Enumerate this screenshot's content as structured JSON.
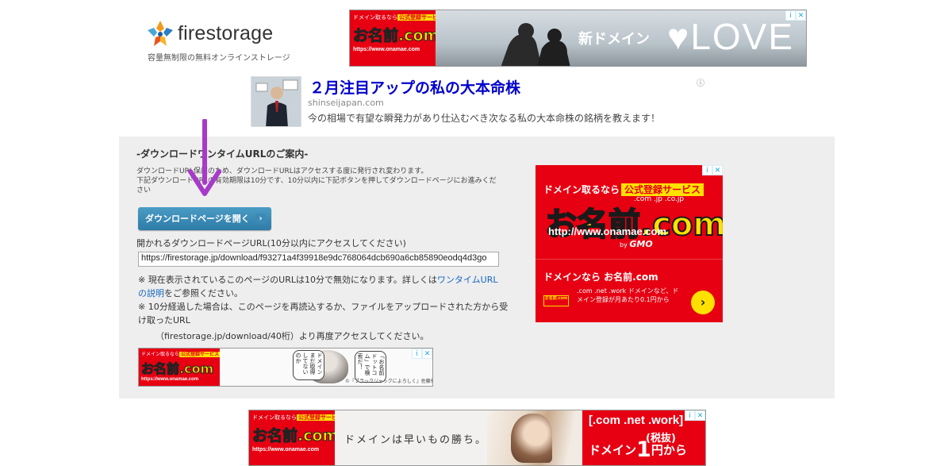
{
  "logo": {
    "name": "firestorage",
    "tagline": "容量無制限の無料オンラインストレージ"
  },
  "ads": {
    "info_icon": "i",
    "close_icon": "✕",
    "onamae": {
      "top_text": "ドメイン取るなら",
      "badge": "公式登録サービス",
      "logo": "お名前.com",
      "url": "https://www.onamae.com",
      "gmo": "by GMO"
    },
    "top_banner": {
      "tagline": "新ドメイン",
      "love": "♥LOVE"
    },
    "native": {
      "title": "２月注目アップの私の大本命株",
      "domain": "shinseijapan.com",
      "description": "今の相場で有望な瞬発力があり仕込むべき次なる私の大本命株の銘柄を教えます！",
      "info": "ⓘ"
    },
    "square": {
      "top_text": "ドメイン取るなら",
      "badge": "公式登録サービス",
      "domains": ".com .jp .co.jp",
      "logo": "お名前.com",
      "url": "http://www.onamae.com",
      "by": "by",
      "gmo": "GMO",
      "headline": "ドメインなら お名前.com",
      "desc": ".com .net .work ドメインなど、ドメイン登録が月あたり0.1円から",
      "mini_logo": "お名前.com",
      "go": "›"
    },
    "small_banner": {
      "bubble1": "「お名前ドットコム」で検索だ！",
      "bubble2": "ドメインまだ取得してないのか",
      "credit": "©『ブラックジャックによろしく』佐藤秀峰"
    },
    "bottom_banner": {
      "slogan": "ドメインは早いもの勝ち。",
      "tld": "[.com .net .work]",
      "tax": "(税抜)",
      "price_prefix": "ドメイン",
      "price_value": "1",
      "price_suffix": "円から"
    }
  },
  "panel": {
    "heading": "-ダウンロードワンタイムURLのご案内-",
    "desc_line1": "ダウンロードURL保護のため、ダウンロードURLはアクセスする度に発行され変わります。",
    "desc_line2": "下記ダウンロードURLの有効期限は10分です、10分以内に下記ボタンを押してダウンロードページにお進みください",
    "open_button": "ダウンロードページを開く",
    "open_button_chevron": "›",
    "url_label": "開かれるダウンロードページURL(10分以内にアクセスしてください)",
    "url_value": "https://firestorage.jp/download/f93271a4f39918e9dc768064dcb690a6cb85890eodq4d3go",
    "note1_prefix": "※ 現在表示されているこのページのURLは10分で無効になります。詳しくは",
    "note1_link": "ワンタイムURLの説明",
    "note1_suffix": "をご参照ください。",
    "note2": "※ 10分経過した場合は、このページを再読込するか、ファイルをアップロードされた方から受け取ったURL",
    "note3": "（firestorage.jp/download/40桁）より再度アクセスしてください。"
  },
  "colors": {
    "brand_red": "#e60012",
    "brand_yellow": "#ffe100",
    "button_blue": "#2e7ba8",
    "link_blue": "#1565c0",
    "annotation_arrow": "#a83ac9",
    "panel_bg": "#eeeeee"
  }
}
